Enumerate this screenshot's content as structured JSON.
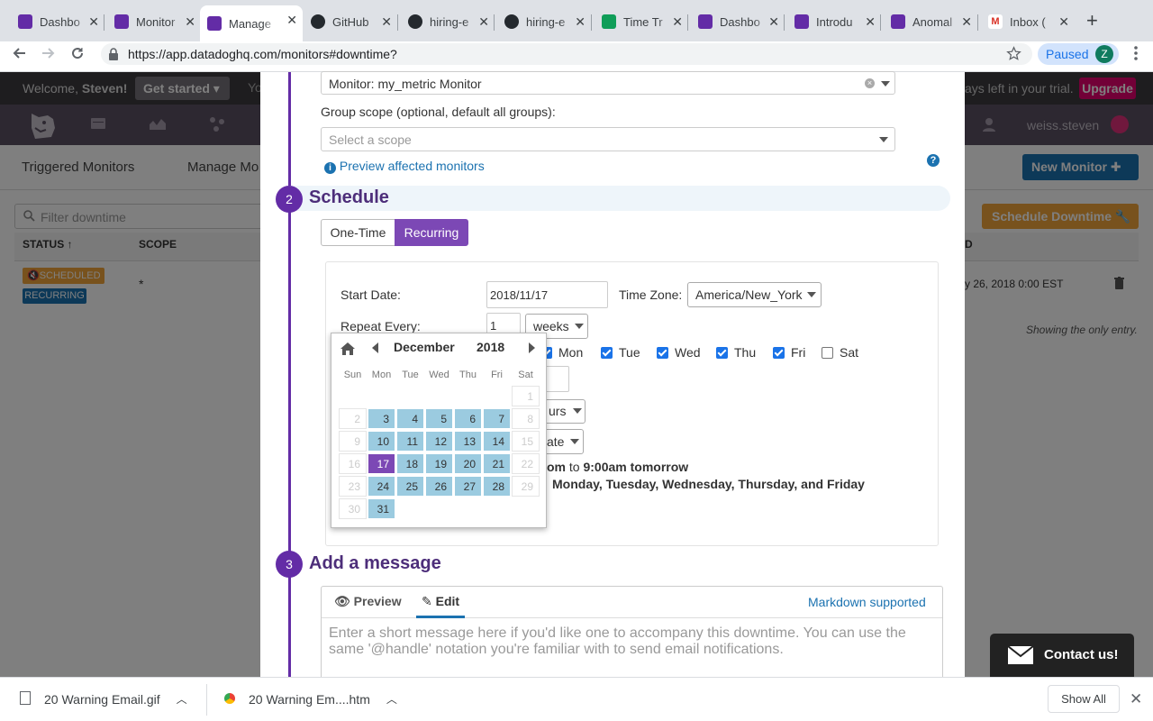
{
  "browser": {
    "tabs": [
      {
        "title": "Dashbo",
        "icon": "datadog-icon"
      },
      {
        "title": "Monitor",
        "icon": "datadog-icon"
      },
      {
        "title": "Manage",
        "icon": "datadog-icon"
      },
      {
        "title": "GitHub",
        "icon": "github-icon"
      },
      {
        "title": "hiring-e",
        "icon": "github-icon"
      },
      {
        "title": "hiring-e",
        "icon": "github-icon"
      },
      {
        "title": "Time Tr",
        "icon": "sheets-icon"
      },
      {
        "title": "Dashbo",
        "icon": "datadog-icon"
      },
      {
        "title": "Introdu",
        "icon": "datadog-icon"
      },
      {
        "title": "Anomal",
        "icon": "datadog-icon"
      },
      {
        "title": "Inbox (",
        "icon": "gmail-icon"
      }
    ],
    "url": "https://app.datadoghq.com/monitors#downtime?",
    "paused_label": "Paused",
    "profile_initial": "Z"
  },
  "datadog": {
    "welcome": "Welcome, ",
    "user_first": "Steven!",
    "get_started": "Get started",
    "trial_text": "ays left in your trial.",
    "upgrade": "Upgrade",
    "top_partial": "Yo",
    "username": "weiss.steven",
    "subnav": {
      "triggered": "Triggered Monitors",
      "manage": "Manage Mo"
    },
    "new_monitor": "New Monitor",
    "filter_placeholder": "Filter downtime",
    "schedule_downtime": "Schedule Downtime",
    "table": {
      "col_status": "STATUS",
      "col_scope": "SCOPE",
      "col_end_partial": "D",
      "row": {
        "badge1": "SCHEDULED",
        "badge2": "RECURRING",
        "scope": "*",
        "end_partial": "y 26, 2018 0:00 EST"
      }
    },
    "showing": "Showing the only entry."
  },
  "modal": {
    "monitor_value": "Monitor: my_metric Monitor",
    "group_scope_label": "Group scope (optional, default all groups):",
    "scope_placeholder": "Select a scope",
    "preview_link": "Preview affected monitors",
    "step2": {
      "num": "2",
      "title": "Schedule"
    },
    "schedule_tabs": {
      "one_time": "One-Time",
      "recurring": "Recurring",
      "active": "recurring"
    },
    "start_date_label": "Start Date:",
    "start_date": "2018/11/17",
    "timezone_label": "Time Zone:",
    "timezone": "America/New_York",
    "repeat_label": "Repeat Every:",
    "repeat_value": "1",
    "repeat_unit": "weeks",
    "weekdays": [
      {
        "label": "Mon",
        "checked": true
      },
      {
        "label": "Tue",
        "checked": true
      },
      {
        "label": "Wed",
        "checked": true
      },
      {
        "label": "Thu",
        "checked": true
      },
      {
        "label": "Fri",
        "checked": true
      },
      {
        "label": "Sat",
        "checked": false
      }
    ],
    "duration_unit_partial": "urs",
    "end_partial": "ate",
    "summary_line1": {
      "from_partial": "om",
      "to": "to",
      "end": "9:00am tomorrow"
    },
    "summary_line2": "Monday, Tuesday, Wednesday, Thursday, and Friday",
    "step3": {
      "num": "3",
      "title": "Add a message"
    },
    "message_tabs": {
      "preview": "Preview",
      "edit": "Edit",
      "active": "edit"
    },
    "markdown_link": "Markdown supported",
    "message_placeholder": "Enter a short message here if you'd like one to accompany this downtime. You can use the same '@handle' notation you're familiar with to send email notifications."
  },
  "calendar": {
    "month": "December",
    "year": "2018",
    "weekday_headers": [
      "Sun",
      "Mon",
      "Tue",
      "Wed",
      "Thu",
      "Fri",
      "Sat"
    ],
    "weeks": [
      [
        null,
        null,
        null,
        null,
        null,
        null,
        {
          "d": "1",
          "s": "dis"
        }
      ],
      [
        {
          "d": "2",
          "s": "dis"
        },
        {
          "d": "3",
          "s": "sel"
        },
        {
          "d": "4",
          "s": "sel"
        },
        {
          "d": "5",
          "s": "sel"
        },
        {
          "d": "6",
          "s": "sel"
        },
        {
          "d": "7",
          "s": "sel"
        },
        {
          "d": "8",
          "s": "dis"
        }
      ],
      [
        {
          "d": "9",
          "s": "dis"
        },
        {
          "d": "10",
          "s": "sel"
        },
        {
          "d": "11",
          "s": "sel"
        },
        {
          "d": "12",
          "s": "sel"
        },
        {
          "d": "13",
          "s": "sel"
        },
        {
          "d": "14",
          "s": "sel"
        },
        {
          "d": "15",
          "s": "dis"
        }
      ],
      [
        {
          "d": "16",
          "s": "dis"
        },
        {
          "d": "17",
          "s": "today"
        },
        {
          "d": "18",
          "s": "sel"
        },
        {
          "d": "19",
          "s": "sel"
        },
        {
          "d": "20",
          "s": "sel"
        },
        {
          "d": "21",
          "s": "sel"
        },
        {
          "d": "22",
          "s": "dis"
        }
      ],
      [
        {
          "d": "23",
          "s": "dis"
        },
        {
          "d": "24",
          "s": "sel"
        },
        {
          "d": "25",
          "s": "sel"
        },
        {
          "d": "26",
          "s": "sel"
        },
        {
          "d": "27",
          "s": "sel"
        },
        {
          "d": "28",
          "s": "sel"
        },
        {
          "d": "29",
          "s": "dis"
        }
      ],
      [
        {
          "d": "30",
          "s": "dis"
        },
        {
          "d": "31",
          "s": "sel"
        },
        null,
        null,
        null,
        null,
        null
      ]
    ]
  },
  "contact_label": "Contact us!",
  "downloads": {
    "items": [
      {
        "name": "20 Warning Email.gif"
      },
      {
        "name": "20 Warning Em....htm"
      }
    ],
    "show_all": "Show All"
  },
  "colors": {
    "brand_purple": "#632ca6",
    "selected_day": "#9bcbe0",
    "today": "#7c48b5",
    "upgrade": "#e5006e",
    "schedule_btn": "#f0a43a",
    "new_monitor_btn": "#1b72b0"
  }
}
